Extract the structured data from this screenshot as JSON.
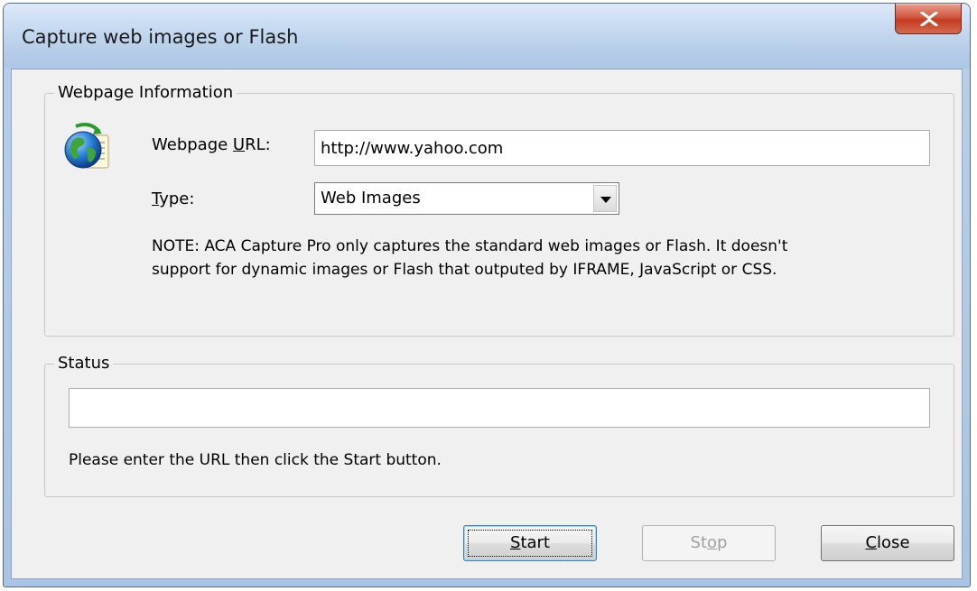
{
  "window": {
    "title": "Capture web images or Flash"
  },
  "webpage_group": {
    "legend": "Webpage Information",
    "icon": "globe-page-icon",
    "url_label_pre": "Webpage ",
    "url_label_mnemonic": "U",
    "url_label_post": "RL:",
    "url_value": "http://www.yahoo.com",
    "type_label_mnemonic": "T",
    "type_label_post": "ype:",
    "type_selected": "Web Images",
    "note_line1": "NOTE: ACA Capture Pro only captures the standard web images or Flash. It doesn't",
    "note_line2": "support for dynamic images or Flash that outputed by IFRAME, JavaScript or CSS."
  },
  "status_group": {
    "legend": "Status",
    "status_value": "",
    "message": "Please enter the URL then click the Start button."
  },
  "buttons": {
    "start_mnemonic": "S",
    "start_rest": "tart",
    "stop_pre": "St",
    "stop_mnemonic": "o",
    "stop_post": "p",
    "close_mnemonic": "C",
    "close_rest": "lose"
  },
  "colors": {
    "close_button": "#c43b20",
    "title_bar": "#c8dbf1",
    "client_bg": "#f0f0f0"
  }
}
